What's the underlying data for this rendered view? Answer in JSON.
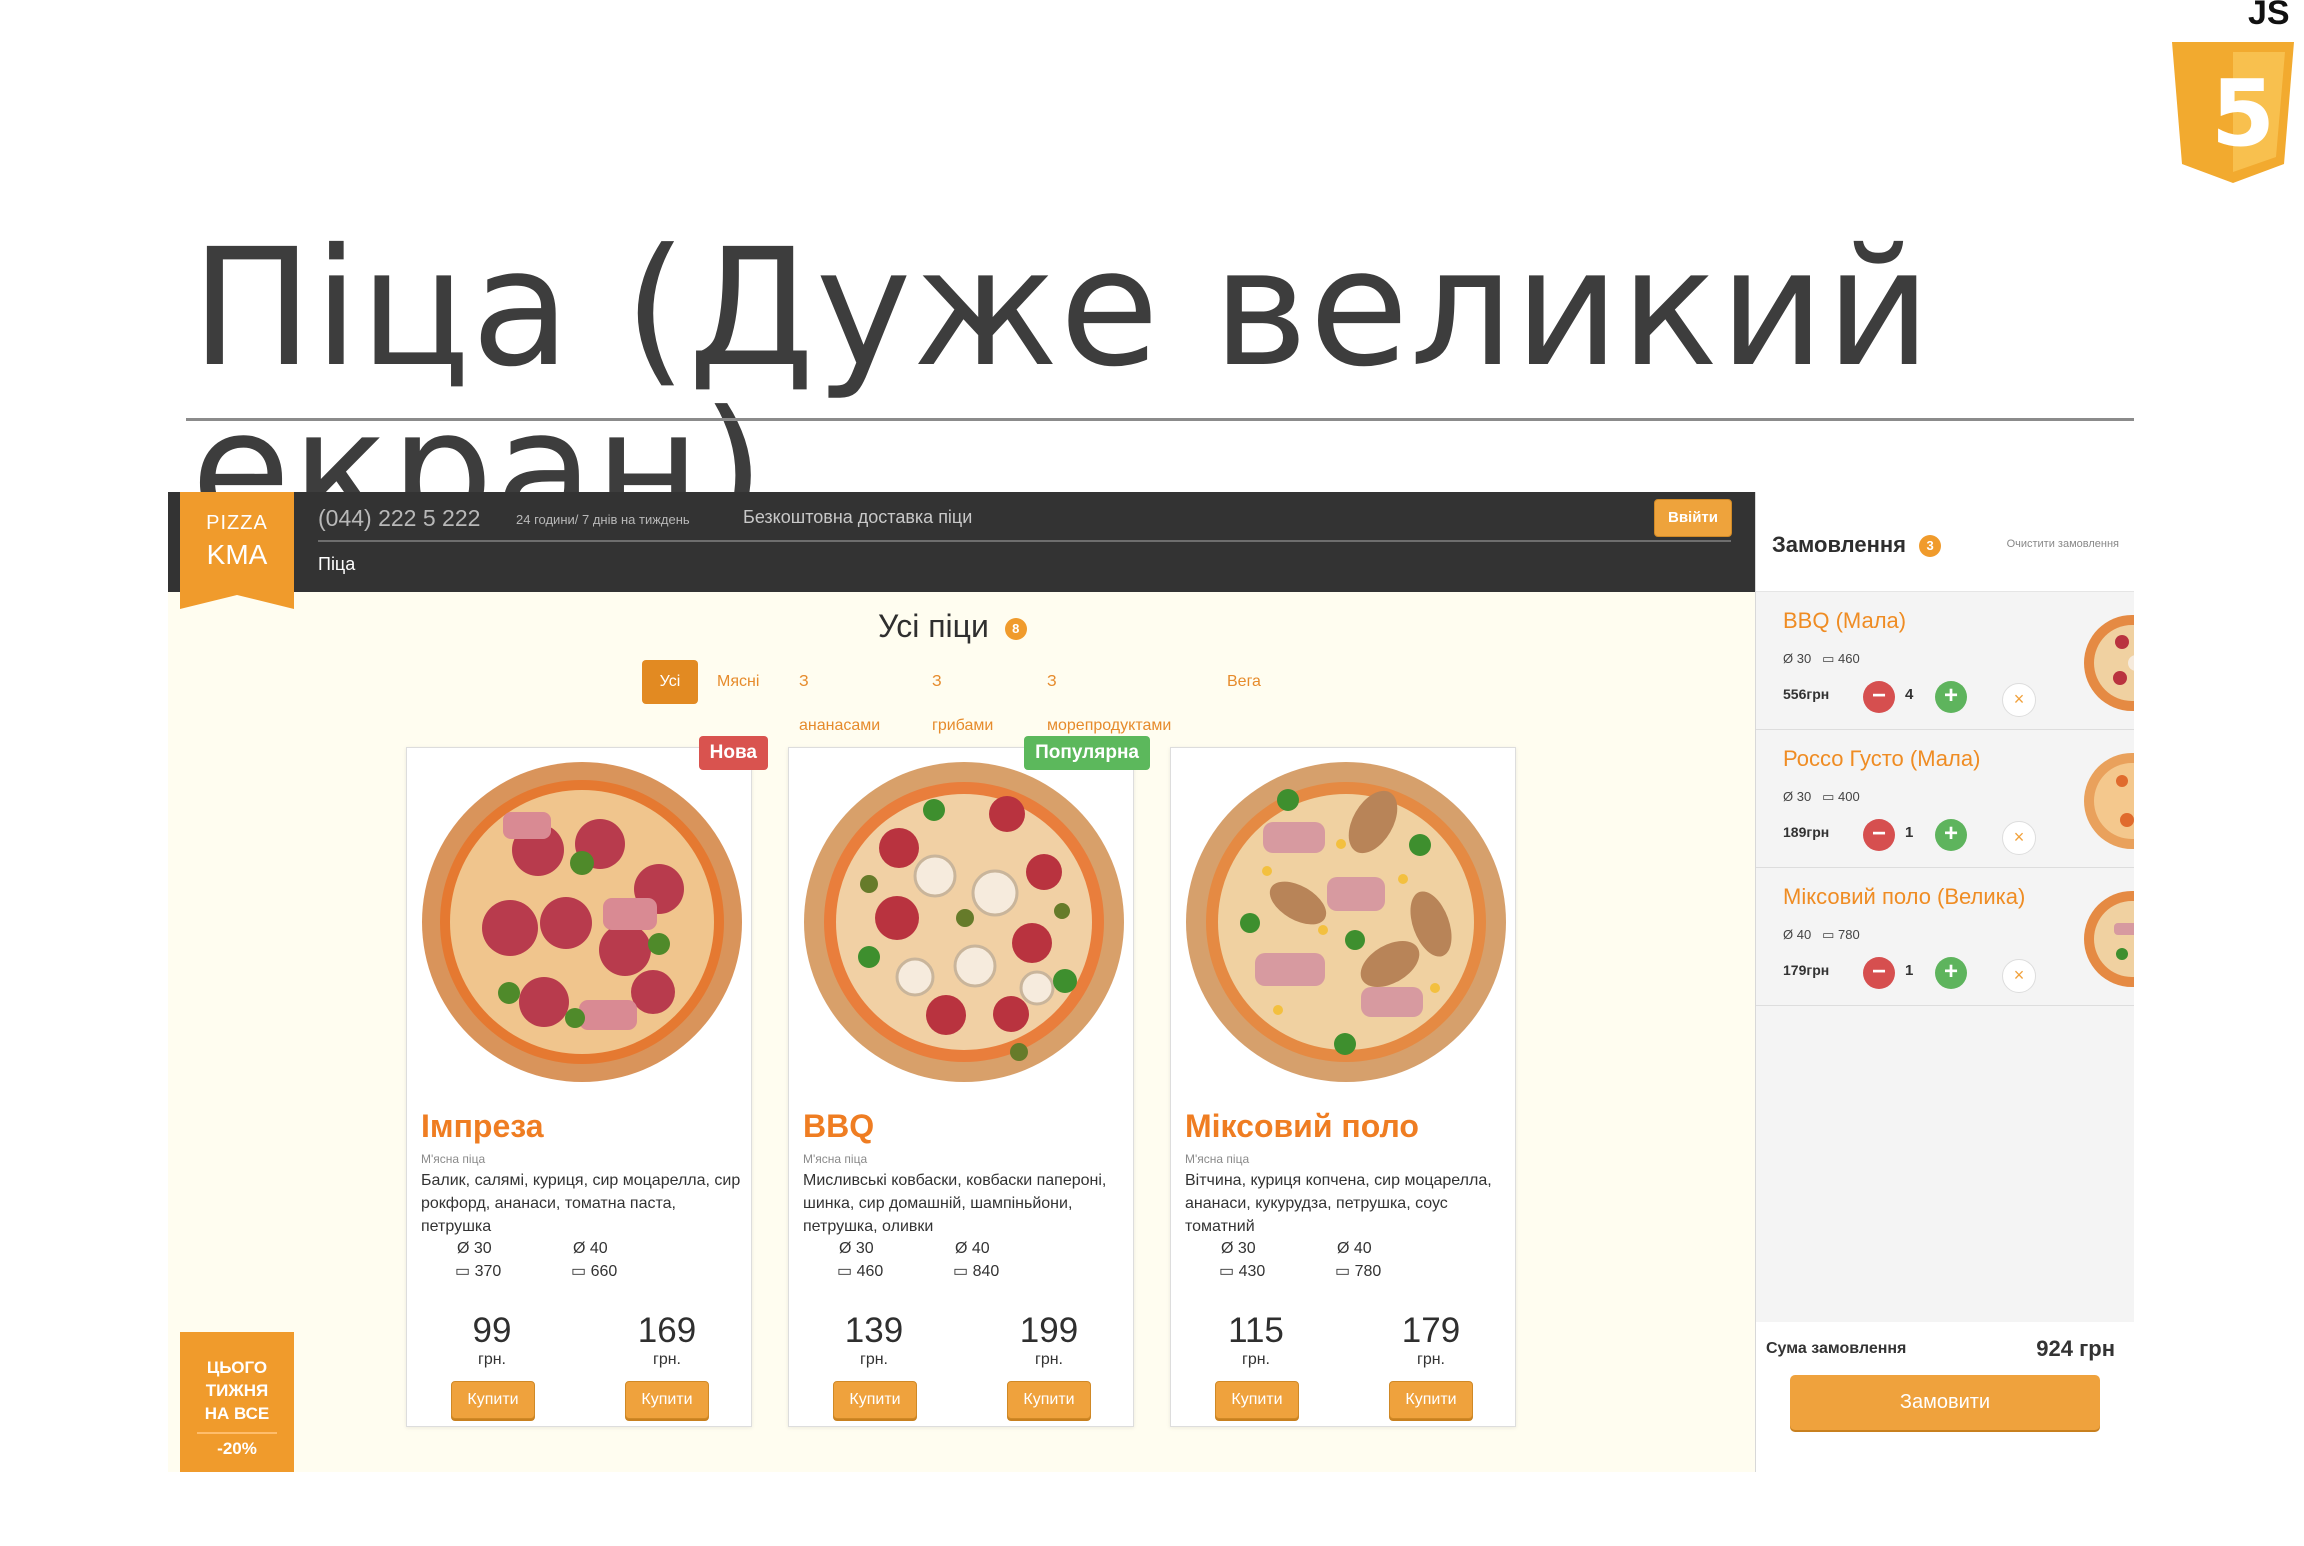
{
  "slide": {
    "title": "Піца (Дуже великий екран)",
    "logo": {
      "top_text": "JS",
      "number": "5"
    }
  },
  "header": {
    "logo_top": "PIZZA",
    "logo_bottom": "KMA",
    "phone": "(044) 222 5 222",
    "hours": "24 години/ 7 днів на тиждень",
    "delivery": "Безкоштовна доставка піци",
    "login": "Ввійти",
    "nav": "Піца"
  },
  "catalog": {
    "title": "Усі піци",
    "count": "8",
    "filters": [
      "Усі",
      "Мясні",
      "З ананасами",
      "З грибами",
      "З морепродуктами",
      "Вега"
    ],
    "active_filter": "Усі",
    "pizzas": [
      {
        "title": "Імпреза",
        "badge": "Нова",
        "type": "М'ясна піца",
        "desc": "Балик, салямі, куриця, сир моцарелла, сир рокфорд, ананаси, томатна паста, петрушка",
        "small": {
          "size": "Ø 30",
          "weight": "370",
          "price": "99",
          "currency": "грн.",
          "buy": "Купити"
        },
        "large": {
          "size": "Ø 40",
          "weight": "660",
          "price": "169",
          "currency": "грн.",
          "buy": "Купити"
        }
      },
      {
        "title": "BBQ",
        "badge": "Популярна",
        "type": "М'ясна піца",
        "desc": "Мисливські ковбаски, ковбаски папероні, шинка, сир домашній, шампіньйони, петрушка, оливки",
        "small": {
          "size": "Ø 30",
          "weight": "460",
          "price": "139",
          "currency": "грн.",
          "buy": "Купити"
        },
        "large": {
          "size": "Ø 40",
          "weight": "840",
          "price": "199",
          "currency": "грн.",
          "buy": "Купити"
        }
      },
      {
        "title": "Міксовий поло",
        "type": "М'ясна піца",
        "desc": "Вітчина, куриця копчена, сир моцарелла, ананаси, кукурудза, петрушка, соус томатний",
        "small": {
          "size": "Ø 30",
          "weight": "430",
          "price": "115",
          "currency": "грн.",
          "buy": "Купити"
        },
        "large": {
          "size": "Ø 40",
          "weight": "780",
          "price": "179",
          "currency": "грн.",
          "buy": "Купити"
        }
      }
    ]
  },
  "promo": {
    "line1": "ЦЬОГО",
    "line2": "ТИЖНЯ",
    "line3": "НА ВСЕ",
    "discount": "-20%"
  },
  "cart": {
    "title": "Замовлення",
    "count": "3",
    "clear": "Очистити замовлення",
    "items": [
      {
        "title": "BBQ (Мала)",
        "size": "30",
        "weight": "460",
        "price": "556грн",
        "qty": "4"
      },
      {
        "title": "Россо Густо (Мала)",
        "size": "30",
        "weight": "400",
        "price": "189грн",
        "qty": "1"
      },
      {
        "title": "Міксовий поло (Велика)",
        "size": "40",
        "weight": "780",
        "price": "179грн",
        "qty": "1"
      }
    ],
    "sum_label": "Сума замовлення",
    "sum": "924 грн",
    "order": "Замовити"
  },
  "icons": {
    "diameter": "diameter-icon",
    "weight": "weight-icon",
    "minus": "minus-icon",
    "plus": "plus-icon",
    "remove": "close-icon"
  },
  "colors": {
    "accent": "#f09b2c",
    "red": "#d9534f",
    "green": "#5cb85c",
    "dark": "#333333"
  }
}
